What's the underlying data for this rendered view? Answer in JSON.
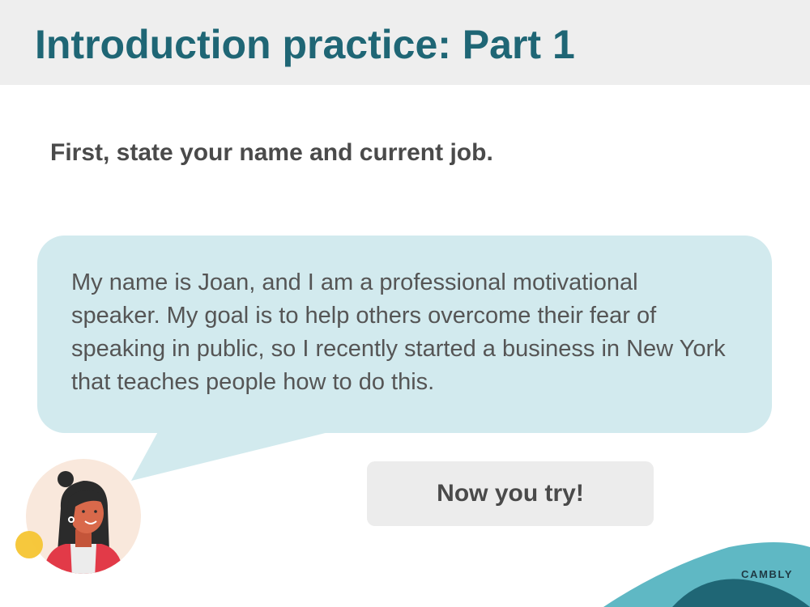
{
  "header": {
    "title": "Introduction practice: Part 1"
  },
  "instruction": "First, state your name and current job.",
  "speech_bubble": {
    "text": "My name is Joan, and I am a professional motivational speaker. My goal is to help others overcome their fear of speaking in public, so I recently started a business in New York that teaches people how to do this."
  },
  "action_button": {
    "label": "Now you try!"
  },
  "brand": {
    "name": "CAMBLY"
  },
  "colors": {
    "title": "#1f6675",
    "header_background": "#eeeeee",
    "bubble": "#d2eaee",
    "button_background": "#ececec",
    "body_text": "#4a4a4a",
    "accent_teal": "#5fb8c4",
    "accent_dark_teal": "#1f6675",
    "accent_yellow": "#f6c533"
  },
  "icons": {
    "avatar": "avatar-joan-illustration",
    "corner": "decorative-wave-shapes"
  }
}
